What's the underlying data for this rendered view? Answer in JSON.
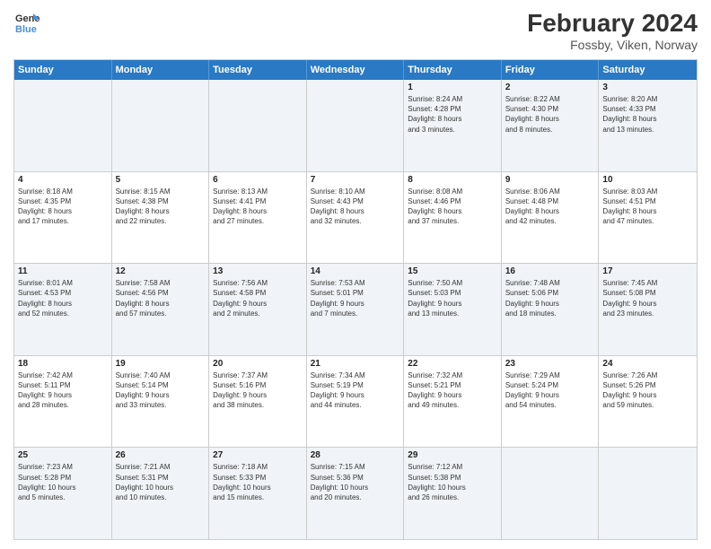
{
  "header": {
    "logo_line1": "General",
    "logo_line2": "Blue",
    "month_year": "February 2024",
    "location": "Fossby, Viken, Norway"
  },
  "weekdays": [
    "Sunday",
    "Monday",
    "Tuesday",
    "Wednesday",
    "Thursday",
    "Friday",
    "Saturday"
  ],
  "rows": [
    [
      {
        "day": "",
        "info": ""
      },
      {
        "day": "",
        "info": ""
      },
      {
        "day": "",
        "info": ""
      },
      {
        "day": "",
        "info": ""
      },
      {
        "day": "1",
        "info": "Sunrise: 8:24 AM\nSunset: 4:28 PM\nDaylight: 8 hours\nand 3 minutes."
      },
      {
        "day": "2",
        "info": "Sunrise: 8:22 AM\nSunset: 4:30 PM\nDaylight: 8 hours\nand 8 minutes."
      },
      {
        "day": "3",
        "info": "Sunrise: 8:20 AM\nSunset: 4:33 PM\nDaylight: 8 hours\nand 13 minutes."
      }
    ],
    [
      {
        "day": "4",
        "info": "Sunrise: 8:18 AM\nSunset: 4:35 PM\nDaylight: 8 hours\nand 17 minutes."
      },
      {
        "day": "5",
        "info": "Sunrise: 8:15 AM\nSunset: 4:38 PM\nDaylight: 8 hours\nand 22 minutes."
      },
      {
        "day": "6",
        "info": "Sunrise: 8:13 AM\nSunset: 4:41 PM\nDaylight: 8 hours\nand 27 minutes."
      },
      {
        "day": "7",
        "info": "Sunrise: 8:10 AM\nSunset: 4:43 PM\nDaylight: 8 hours\nand 32 minutes."
      },
      {
        "day": "8",
        "info": "Sunrise: 8:08 AM\nSunset: 4:46 PM\nDaylight: 8 hours\nand 37 minutes."
      },
      {
        "day": "9",
        "info": "Sunrise: 8:06 AM\nSunset: 4:48 PM\nDaylight: 8 hours\nand 42 minutes."
      },
      {
        "day": "10",
        "info": "Sunrise: 8:03 AM\nSunset: 4:51 PM\nDaylight: 8 hours\nand 47 minutes."
      }
    ],
    [
      {
        "day": "11",
        "info": "Sunrise: 8:01 AM\nSunset: 4:53 PM\nDaylight: 8 hours\nand 52 minutes."
      },
      {
        "day": "12",
        "info": "Sunrise: 7:58 AM\nSunset: 4:56 PM\nDaylight: 8 hours\nand 57 minutes."
      },
      {
        "day": "13",
        "info": "Sunrise: 7:56 AM\nSunset: 4:58 PM\nDaylight: 9 hours\nand 2 minutes."
      },
      {
        "day": "14",
        "info": "Sunrise: 7:53 AM\nSunset: 5:01 PM\nDaylight: 9 hours\nand 7 minutes."
      },
      {
        "day": "15",
        "info": "Sunrise: 7:50 AM\nSunset: 5:03 PM\nDaylight: 9 hours\nand 13 minutes."
      },
      {
        "day": "16",
        "info": "Sunrise: 7:48 AM\nSunset: 5:06 PM\nDaylight: 9 hours\nand 18 minutes."
      },
      {
        "day": "17",
        "info": "Sunrise: 7:45 AM\nSunset: 5:08 PM\nDaylight: 9 hours\nand 23 minutes."
      }
    ],
    [
      {
        "day": "18",
        "info": "Sunrise: 7:42 AM\nSunset: 5:11 PM\nDaylight: 9 hours\nand 28 minutes."
      },
      {
        "day": "19",
        "info": "Sunrise: 7:40 AM\nSunset: 5:14 PM\nDaylight: 9 hours\nand 33 minutes."
      },
      {
        "day": "20",
        "info": "Sunrise: 7:37 AM\nSunset: 5:16 PM\nDaylight: 9 hours\nand 38 minutes."
      },
      {
        "day": "21",
        "info": "Sunrise: 7:34 AM\nSunset: 5:19 PM\nDaylight: 9 hours\nand 44 minutes."
      },
      {
        "day": "22",
        "info": "Sunrise: 7:32 AM\nSunset: 5:21 PM\nDaylight: 9 hours\nand 49 minutes."
      },
      {
        "day": "23",
        "info": "Sunrise: 7:29 AM\nSunset: 5:24 PM\nDaylight: 9 hours\nand 54 minutes."
      },
      {
        "day": "24",
        "info": "Sunrise: 7:26 AM\nSunset: 5:26 PM\nDaylight: 9 hours\nand 59 minutes."
      }
    ],
    [
      {
        "day": "25",
        "info": "Sunrise: 7:23 AM\nSunset: 5:28 PM\nDaylight: 10 hours\nand 5 minutes."
      },
      {
        "day": "26",
        "info": "Sunrise: 7:21 AM\nSunset: 5:31 PM\nDaylight: 10 hours\nand 10 minutes."
      },
      {
        "day": "27",
        "info": "Sunrise: 7:18 AM\nSunset: 5:33 PM\nDaylight: 10 hours\nand 15 minutes."
      },
      {
        "day": "28",
        "info": "Sunrise: 7:15 AM\nSunset: 5:36 PM\nDaylight: 10 hours\nand 20 minutes."
      },
      {
        "day": "29",
        "info": "Sunrise: 7:12 AM\nSunset: 5:38 PM\nDaylight: 10 hours\nand 26 minutes."
      },
      {
        "day": "",
        "info": ""
      },
      {
        "day": "",
        "info": ""
      }
    ]
  ],
  "alt_rows": [
    0,
    2,
    4
  ]
}
